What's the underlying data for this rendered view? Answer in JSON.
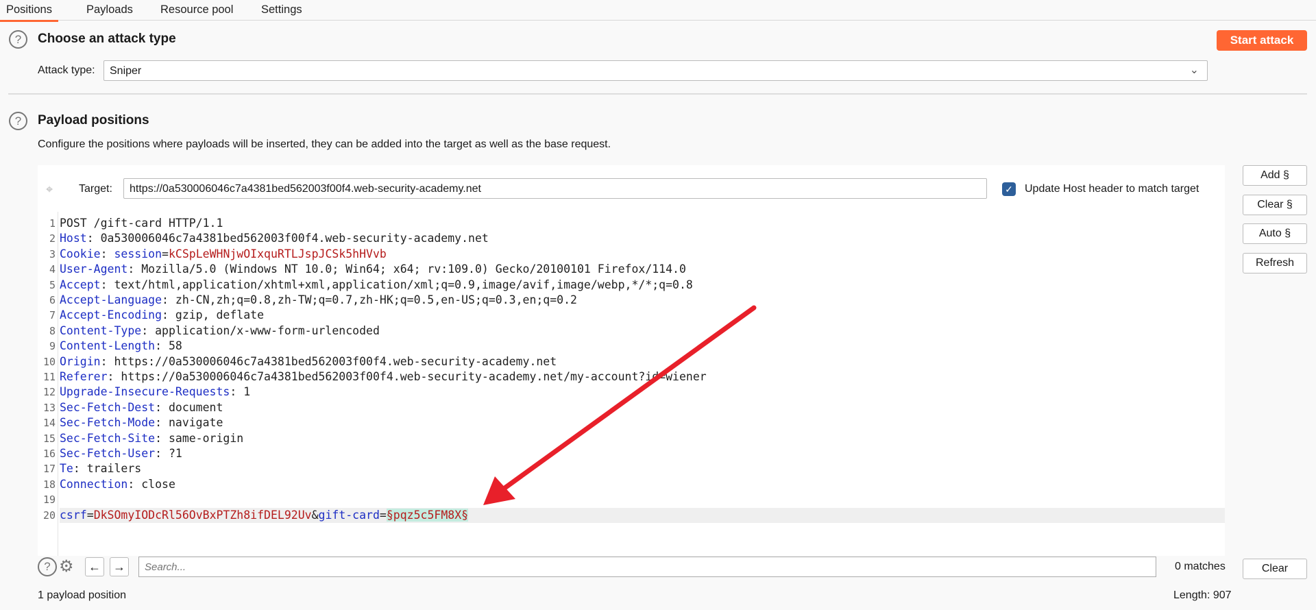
{
  "tabs": [
    {
      "label": "Positions",
      "active": true
    },
    {
      "label": "Payloads"
    },
    {
      "label": "Resource pool"
    },
    {
      "label": "Settings"
    }
  ],
  "attack_section": {
    "title": "Choose an attack type",
    "start_label": "Start attack",
    "attack_type_label": "Attack type:",
    "attack_type_value": "Sniper"
  },
  "positions_section": {
    "title": "Payload positions",
    "description": "Configure the positions where payloads will be inserted, they can be added into the target as well as the base request."
  },
  "target": {
    "label": "Target:",
    "value": "https://0a530006046c7a4381bed562003f00f4.web-security-academy.net",
    "update_host_label": "Update Host header to match target",
    "update_host_checked": true
  },
  "side_buttons": {
    "add": "Add §",
    "clear": "Clear §",
    "auto": "Auto §",
    "refresh": "Refresh"
  },
  "request_lines": [
    {
      "n": "1",
      "plain": "POST /gift-card HTTP/1.1"
    },
    {
      "n": "2",
      "key": "Host",
      "value": ": 0a530006046c7a4381bed562003f00f4.web-security-academy.net"
    },
    {
      "n": "3",
      "key": "Cookie",
      "value": ": ",
      "ckey": "session",
      "ceq": "=",
      "cval": "kCSpLeWHNjwOIxquRTLJspJCSk5hHVvb"
    },
    {
      "n": "4",
      "key": "User-Agent",
      "value": ": Mozilla/5.0 (Windows NT 10.0; Win64; x64; rv:109.0) Gecko/20100101 Firefox/114.0"
    },
    {
      "n": "5",
      "key": "Accept",
      "value": ": text/html,application/xhtml+xml,application/xml;q=0.9,image/avif,image/webp,*/*;q=0.8"
    },
    {
      "n": "6",
      "key": "Accept-Language",
      "value": ": zh-CN,zh;q=0.8,zh-TW;q=0.7,zh-HK;q=0.5,en-US;q=0.3,en;q=0.2"
    },
    {
      "n": "7",
      "key": "Accept-Encoding",
      "value": ": gzip, deflate"
    },
    {
      "n": "8",
      "key": "Content-Type",
      "value": ": application/x-www-form-urlencoded"
    },
    {
      "n": "9",
      "key": "Content-Length",
      "value": ": 58"
    },
    {
      "n": "10",
      "key": "Origin",
      "value": ": https://0a530006046c7a4381bed562003f00f4.web-security-academy.net"
    },
    {
      "n": "11",
      "key": "Referer",
      "value": ": https://0a530006046c7a4381bed562003f00f4.web-security-academy.net/my-account?id=wiener"
    },
    {
      "n": "12",
      "key": "Upgrade-Insecure-Requests",
      "value": ": 1"
    },
    {
      "n": "13",
      "key": "Sec-Fetch-Dest",
      "value": ": document"
    },
    {
      "n": "14",
      "key": "Sec-Fetch-Mode",
      "value": ": navigate"
    },
    {
      "n": "15",
      "key": "Sec-Fetch-Site",
      "value": ": same-origin"
    },
    {
      "n": "16",
      "key": "Sec-Fetch-User",
      "value": ": ?1"
    },
    {
      "n": "17",
      "key": "Te",
      "value": ": trailers"
    },
    {
      "n": "18",
      "key": "Connection",
      "value": ": close"
    },
    {
      "n": "19",
      "plain": ""
    }
  ],
  "body_line": {
    "n": "20",
    "k1": "csrf",
    "eq1": "=",
    "v1": "DkSOmyIODcRl56OvBxPTZh8ifDEL92Uv",
    "amp": "&",
    "k2": "gift-card",
    "eq2": "=",
    "payload": "§pqz5c5FM8X§"
  },
  "search": {
    "placeholder": "Search...",
    "matches": "0 matches",
    "clear": "Clear"
  },
  "status": {
    "positions": "1 payload position",
    "length": "Length: 907"
  },
  "colors": {
    "accent": "#ff6633",
    "header_key": "#1d2ec4",
    "value_red": "#b51c1c",
    "payload_bg": "#c4ece0",
    "annotation_arrow": "#e8202a"
  }
}
